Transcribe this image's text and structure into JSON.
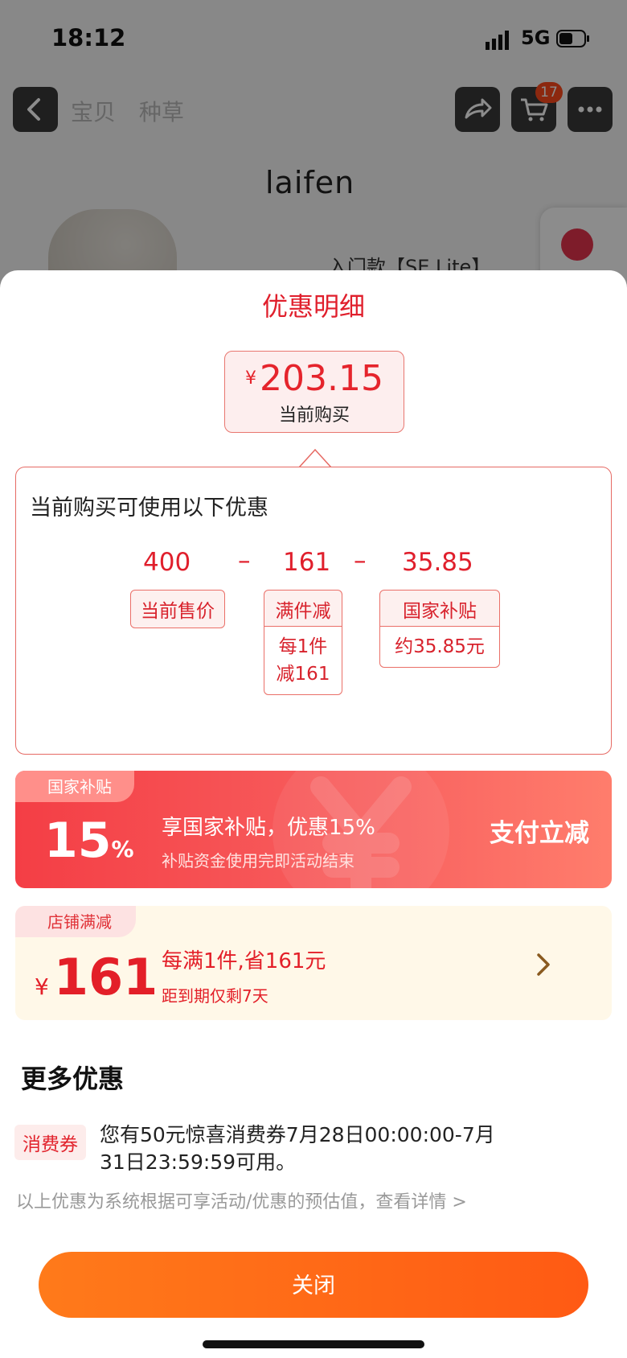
{
  "status_bar": {
    "time": "18:12",
    "network": "5G"
  },
  "nav": {
    "tabs": [
      "宝贝",
      "种草"
    ],
    "cart_count": "17"
  },
  "product": {
    "brand": "laifen",
    "name": "入门款【SE Lite】"
  },
  "sheet": {
    "title": "优惠明细",
    "price": {
      "symbol": "¥",
      "value": "203.15",
      "label": "当前购买"
    },
    "promo_box": {
      "heading": "当前购买可使用以下优惠",
      "calc": {
        "base": "400",
        "op1": "–",
        "discount1": "161",
        "op2": "–",
        "discount2": "35.85"
      },
      "tags": {
        "base": "当前售价",
        "discount1_head": "满件减",
        "discount1_sub": "每1件\n减161",
        "discount2_head": "国家补贴",
        "discount2_sub": "约35.85元"
      }
    },
    "gov_card": {
      "tag": "国家补贴",
      "pct_num": "15",
      "pct_unit": "%",
      "title": "享国家补贴，优惠15%",
      "desc": "补贴资金使用完即活动结束",
      "action": "支付立减"
    },
    "store_card": {
      "tag": "店铺满减",
      "symbol": "¥",
      "amount": "161",
      "title": "每满1件,省161元",
      "desc": "距到期仅剩7天"
    },
    "more": {
      "heading": "更多优惠",
      "coupon_tag": "消费券",
      "coupon_text": "您有50元惊喜消费券7月28日00:00:00-7月31日23:59:59可用。",
      "disclaimer": "以上优惠为系统根据可享活动/优惠的预估值，查看详情 >"
    },
    "close_label": "关闭"
  },
  "colors": {
    "accent_red": "#e01f2c",
    "close_orange": "#ff6a16",
    "store_bg": "#fff8e8"
  }
}
